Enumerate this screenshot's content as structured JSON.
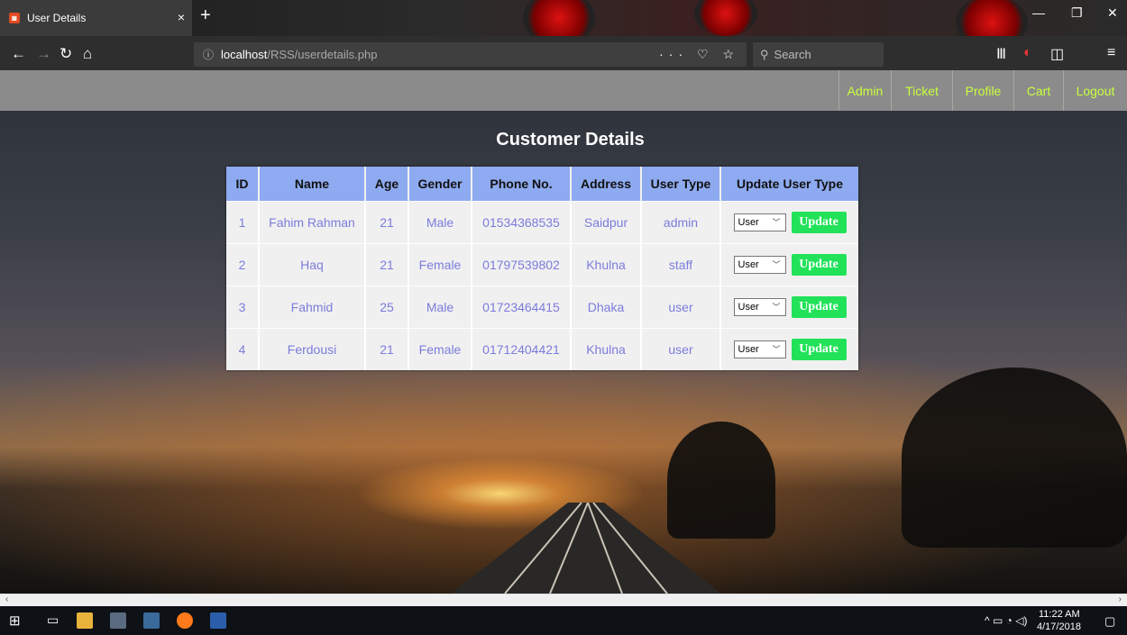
{
  "browser": {
    "tab_title": "User Details",
    "tab_close": "×",
    "new_tab": "+",
    "url_host": "localhost",
    "url_path": "/RSS/userdetails.php",
    "search_placeholder": "Search",
    "url_actions": "··· ♡ ☆"
  },
  "nav": {
    "items": [
      "Admin",
      "Ticket",
      "Profile",
      "Cart",
      "Logout"
    ]
  },
  "page": {
    "title": "Customer Details"
  },
  "table": {
    "headers": [
      "ID",
      "Name",
      "Age",
      "Gender",
      "Phone No.",
      "Address",
      "User Type",
      "Update User Type"
    ],
    "rows": [
      {
        "id": "1",
        "name": "Fahim Rahman",
        "age": "21",
        "gender": "Male",
        "phone": "01534368535",
        "address": "Saidpur",
        "type": "admin",
        "select": "User",
        "button": "Update"
      },
      {
        "id": "2",
        "name": "Haq",
        "age": "21",
        "gender": "Female",
        "phone": "01797539802",
        "address": "Khulna",
        "type": "staff",
        "select": "User",
        "button": "Update"
      },
      {
        "id": "3",
        "name": "Fahmid",
        "age": "25",
        "gender": "Male",
        "phone": "01723464415",
        "address": "Dhaka",
        "type": "user",
        "select": "User",
        "button": "Update"
      },
      {
        "id": "4",
        "name": "Ferdousi",
        "age": "21",
        "gender": "Female",
        "phone": "01712404421",
        "address": "Khulna",
        "type": "user",
        "select": "User",
        "button": "Update"
      }
    ]
  },
  "taskbar": {
    "time": "11:22 AM",
    "date": "4/17/2018"
  },
  "colors": {
    "menu_text": "#c8ff3c",
    "header_bg": "#8eaaf0",
    "cell_text": "#7c7cdc",
    "update_button": "#22e25a"
  }
}
